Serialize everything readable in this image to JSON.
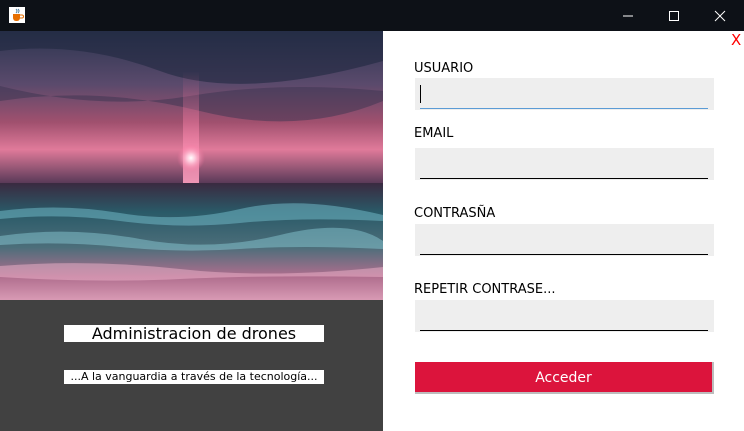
{
  "window": {
    "app_icon": "java-cup-icon",
    "controls": {
      "minimize": "minimize-icon",
      "maximize": "maximize-icon",
      "close": "close-icon"
    }
  },
  "left_panel": {
    "image": "sunset-sea-photo",
    "title": "Administracion de drones",
    "subtitle": "...A la vanguardia a través de la tecnología..."
  },
  "form": {
    "close_label": "X",
    "fields": [
      {
        "label": "USUARIO",
        "value": ""
      },
      {
        "label": "EMAIL",
        "value": ""
      },
      {
        "label": "CONTRASÑA",
        "value": ""
      },
      {
        "label": "REPETIR CONTRASE...",
        "value": ""
      }
    ],
    "submit_label": "Acceder"
  },
  "colors": {
    "titlebar": "#0d1117",
    "left_panel": "#414141",
    "accent_button": "#dc143c",
    "close_x": "#ff0000",
    "field_bg": "#eeeeee",
    "focus_underline": "#5b9bd5"
  }
}
